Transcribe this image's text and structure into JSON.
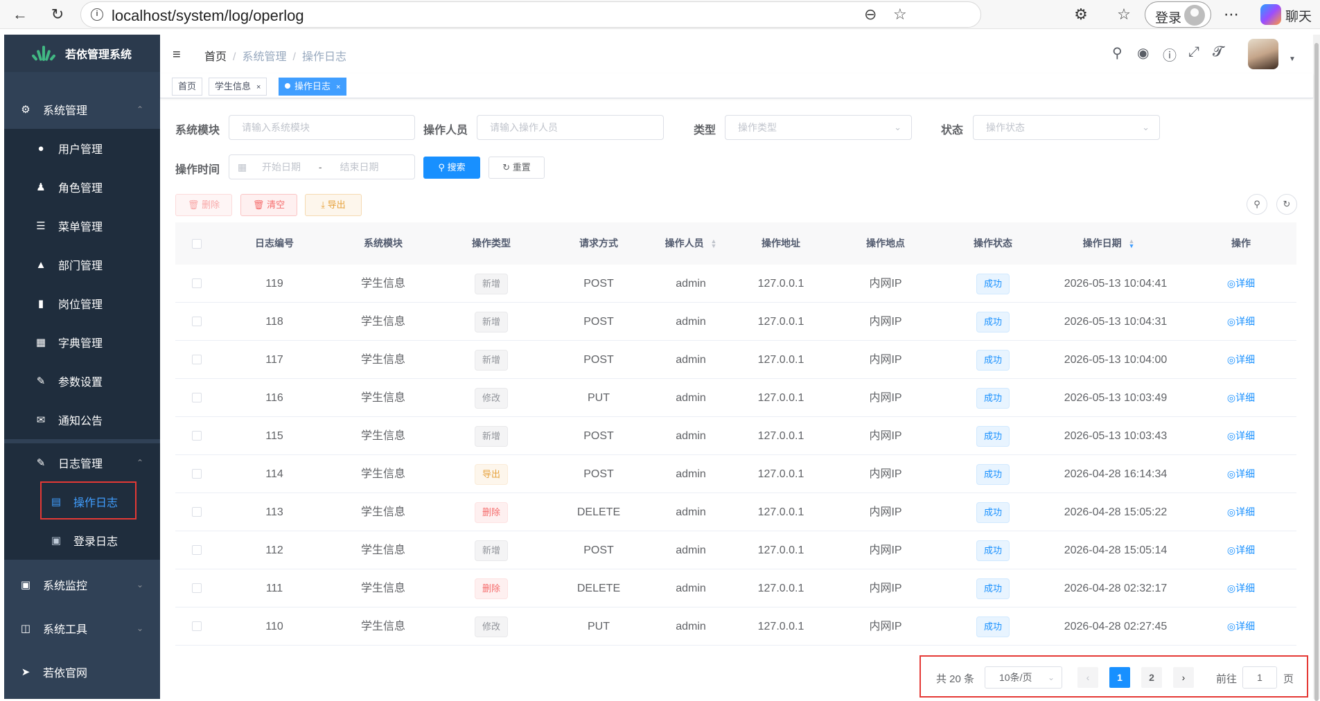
{
  "browser": {
    "url": "localhost/system/log/operlog",
    "login_label": "登录",
    "chat_label": "聊天"
  },
  "sidebar": {
    "title": "若依管理系统",
    "items": [
      {
        "label": "系统管理",
        "icon": "gear-icon"
      },
      {
        "label": "用户管理",
        "icon": "user-icon"
      },
      {
        "label": "角色管理",
        "icon": "peoples-icon"
      },
      {
        "label": "菜单管理",
        "icon": "tree-table-icon"
      },
      {
        "label": "部门管理",
        "icon": "tree-icon"
      },
      {
        "label": "岗位管理",
        "icon": "post-icon"
      },
      {
        "label": "字典管理",
        "icon": "dict-icon"
      },
      {
        "label": "参数设置",
        "icon": "edit-icon"
      },
      {
        "label": "通知公告",
        "icon": "message-icon"
      },
      {
        "label": "日志管理",
        "icon": "log-icon"
      },
      {
        "label": "操作日志",
        "icon": "form-icon"
      },
      {
        "label": "登录日志",
        "icon": "logininfor-icon"
      },
      {
        "label": "系统监控",
        "icon": "monitor-icon"
      },
      {
        "label": "系统工具",
        "icon": "tool-icon"
      },
      {
        "label": "若依官网",
        "icon": "guide-icon"
      }
    ]
  },
  "navbar": {
    "breadcrumb": [
      "首页",
      "系统管理",
      "操作日志"
    ]
  },
  "tags": [
    {
      "label": "首页"
    },
    {
      "label": "学生信息"
    },
    {
      "label": "操作日志"
    }
  ],
  "search": {
    "module_label": "系统模块",
    "module_placeholder": "请输入系统模块",
    "operator_label": "操作人员",
    "operator_placeholder": "请输入操作人员",
    "type_label": "类型",
    "type_placeholder": "操作类型",
    "status_label": "状态",
    "status_placeholder": "操作状态",
    "time_label": "操作时间",
    "start_placeholder": "开始日期",
    "range_sep": "-",
    "end_placeholder": "结束日期",
    "search_button": "搜索",
    "reset_button": "重置"
  },
  "toolbar": {
    "delete": "删除",
    "clear": "清空",
    "export": "导出"
  },
  "table": {
    "headers": [
      "日志编号",
      "系统模块",
      "操作类型",
      "请求方式",
      "操作人员",
      "操作地址",
      "操作地点",
      "操作状态",
      "操作日期",
      "操作"
    ],
    "detail_label": "详细",
    "rows": [
      {
        "id": "119",
        "module": "学生信息",
        "type": "新增",
        "type_style": "info",
        "method": "POST",
        "operator": "admin",
        "ip": "127.0.0.1",
        "location": "内网IP",
        "status": "成功",
        "date": "2026-05-13 10:04:41"
      },
      {
        "id": "118",
        "module": "学生信息",
        "type": "新增",
        "type_style": "info",
        "method": "POST",
        "operator": "admin",
        "ip": "127.0.0.1",
        "location": "内网IP",
        "status": "成功",
        "date": "2026-05-13 10:04:31"
      },
      {
        "id": "117",
        "module": "学生信息",
        "type": "新增",
        "type_style": "info",
        "method": "POST",
        "operator": "admin",
        "ip": "127.0.0.1",
        "location": "内网IP",
        "status": "成功",
        "date": "2026-05-13 10:04:00"
      },
      {
        "id": "116",
        "module": "学生信息",
        "type": "修改",
        "type_style": "info",
        "method": "PUT",
        "operator": "admin",
        "ip": "127.0.0.1",
        "location": "内网IP",
        "status": "成功",
        "date": "2026-05-13 10:03:49"
      },
      {
        "id": "115",
        "module": "学生信息",
        "type": "新增",
        "type_style": "info",
        "method": "POST",
        "operator": "admin",
        "ip": "127.0.0.1",
        "location": "内网IP",
        "status": "成功",
        "date": "2026-05-13 10:03:43"
      },
      {
        "id": "114",
        "module": "学生信息",
        "type": "导出",
        "type_style": "warning",
        "method": "POST",
        "operator": "admin",
        "ip": "127.0.0.1",
        "location": "内网IP",
        "status": "成功",
        "date": "2026-04-28 16:14:34"
      },
      {
        "id": "113",
        "module": "学生信息",
        "type": "删除",
        "type_style": "danger",
        "method": "DELETE",
        "operator": "admin",
        "ip": "127.0.0.1",
        "location": "内网IP",
        "status": "成功",
        "date": "2026-04-28 15:05:22"
      },
      {
        "id": "112",
        "module": "学生信息",
        "type": "新增",
        "type_style": "info",
        "method": "POST",
        "operator": "admin",
        "ip": "127.0.0.1",
        "location": "内网IP",
        "status": "成功",
        "date": "2026-04-28 15:05:14"
      },
      {
        "id": "111",
        "module": "学生信息",
        "type": "删除",
        "type_style": "danger",
        "method": "DELETE",
        "operator": "admin",
        "ip": "127.0.0.1",
        "location": "内网IP",
        "status": "成功",
        "date": "2026-04-28 02:32:17"
      },
      {
        "id": "110",
        "module": "学生信息",
        "type": "修改",
        "type_style": "info",
        "method": "PUT",
        "operator": "admin",
        "ip": "127.0.0.1",
        "location": "内网IP",
        "status": "成功",
        "date": "2026-04-28 02:27:45"
      }
    ]
  },
  "pagination": {
    "total_text": "共 20 条",
    "page_size": "10条/页",
    "pages": [
      "1",
      "2"
    ],
    "current_page": "1",
    "goto_label": "前往",
    "goto_value": "1",
    "page_unit": "页"
  },
  "colors": {
    "sidebar_bg": "#304156",
    "primary": "#1890ff",
    "highlight_border": "#e53935"
  }
}
